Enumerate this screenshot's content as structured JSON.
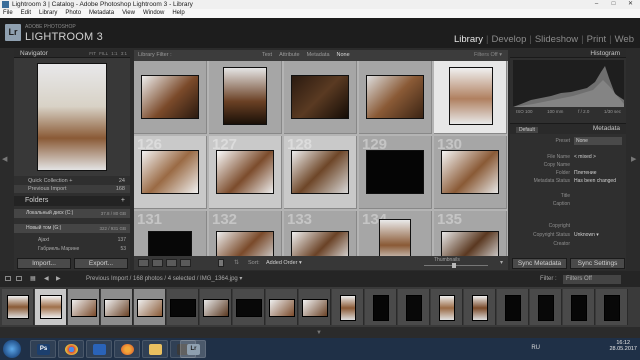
{
  "window": {
    "title": "Lightroom 3 | Catalog - Adobe Photoshop Lightroom 3 - Library",
    "buttons": [
      "–",
      "□",
      "✕"
    ]
  },
  "menu": [
    "File",
    "Edit",
    "Library",
    "Photo",
    "Metadata",
    "View",
    "Window",
    "Help"
  ],
  "identity": {
    "logo": "Lr",
    "small": "ADOBE PHOTOSHOP",
    "big": "LIGHTROOM 3"
  },
  "modules": [
    "Library",
    "Develop",
    "Slideshow",
    "Print",
    "Web"
  ],
  "active_module": "Library",
  "navigator": {
    "title": "Navigator",
    "zoom_options": "FIT FILL 1:1 3:1"
  },
  "catalog": [
    {
      "label": "Quick Collection +",
      "count": "24"
    },
    {
      "label": "Previous Import",
      "count": "168"
    }
  ],
  "folders": {
    "title": "Folders",
    "drives": [
      {
        "label": "Локальный диск (C:)",
        "meta": "37.8 / 80 GB"
      },
      {
        "label": "Новый том (G:)",
        "meta": "322 / 931 GB"
      }
    ],
    "items": [
      {
        "label": "Ajaxt",
        "count": "137"
      },
      {
        "label": "Габриель Марине",
        "count": "53"
      }
    ]
  },
  "left_buttons": {
    "import": "Import...",
    "export": "Export..."
  },
  "library_filter": {
    "title": "Library Filter :",
    "options": [
      "Text",
      "Attribute",
      "Metadata",
      "None"
    ],
    "status": "Filters Off ▾"
  },
  "grid": {
    "numbers": [
      "",
      "",
      "",
      "",
      "",
      "126",
      "127",
      "128",
      "129",
      "130",
      "131",
      "132",
      "133",
      "134",
      "135"
    ]
  },
  "toolbar": {
    "sort_label": "Sort:",
    "sort_value": "Added Order ▾",
    "thumbnails_label": "Thumbnails"
  },
  "histogram": {
    "title": "Histogram",
    "iso": "ISO 100",
    "focal": "100 mm",
    "aperture": "f / 2.0",
    "shutter": "1/30 sec"
  },
  "metadata": {
    "title": "Metadata",
    "preset_select": "Default",
    "fields": [
      {
        "label": "Preset",
        "value": "None"
      },
      {
        "label": "File Name",
        "value": "< mixed >"
      },
      {
        "label": "Copy Name",
        "value": ""
      },
      {
        "label": "Folder",
        "value": "Плетение"
      },
      {
        "label": "Metadata Status",
        "value": "Has been changed"
      },
      {
        "label": "Title",
        "value": ""
      },
      {
        "label": "Caption",
        "value": ""
      },
      {
        "label": "Copyright",
        "value": ""
      },
      {
        "label": "Copyright Status",
        "value": "Unknown ▾"
      },
      {
        "label": "Creator",
        "value": ""
      }
    ]
  },
  "right_buttons": {
    "sync_metadata": "Sync Metadata",
    "sync_settings": "Sync Settings"
  },
  "filmstrip_bar": {
    "source": "Previous Import / 168 photos / 4 selected / IMG_1364.jpg ▾",
    "filter_label": "Filter :",
    "filter_value": "Filters Off"
  },
  "taskbar": {
    "lang": "RU",
    "time": "16:12",
    "date": "28.05.2017"
  },
  "colors": {
    "accent": "#8fa0b0",
    "grid_bg": "#b4b4b4",
    "taskbar": "#1f3047"
  }
}
